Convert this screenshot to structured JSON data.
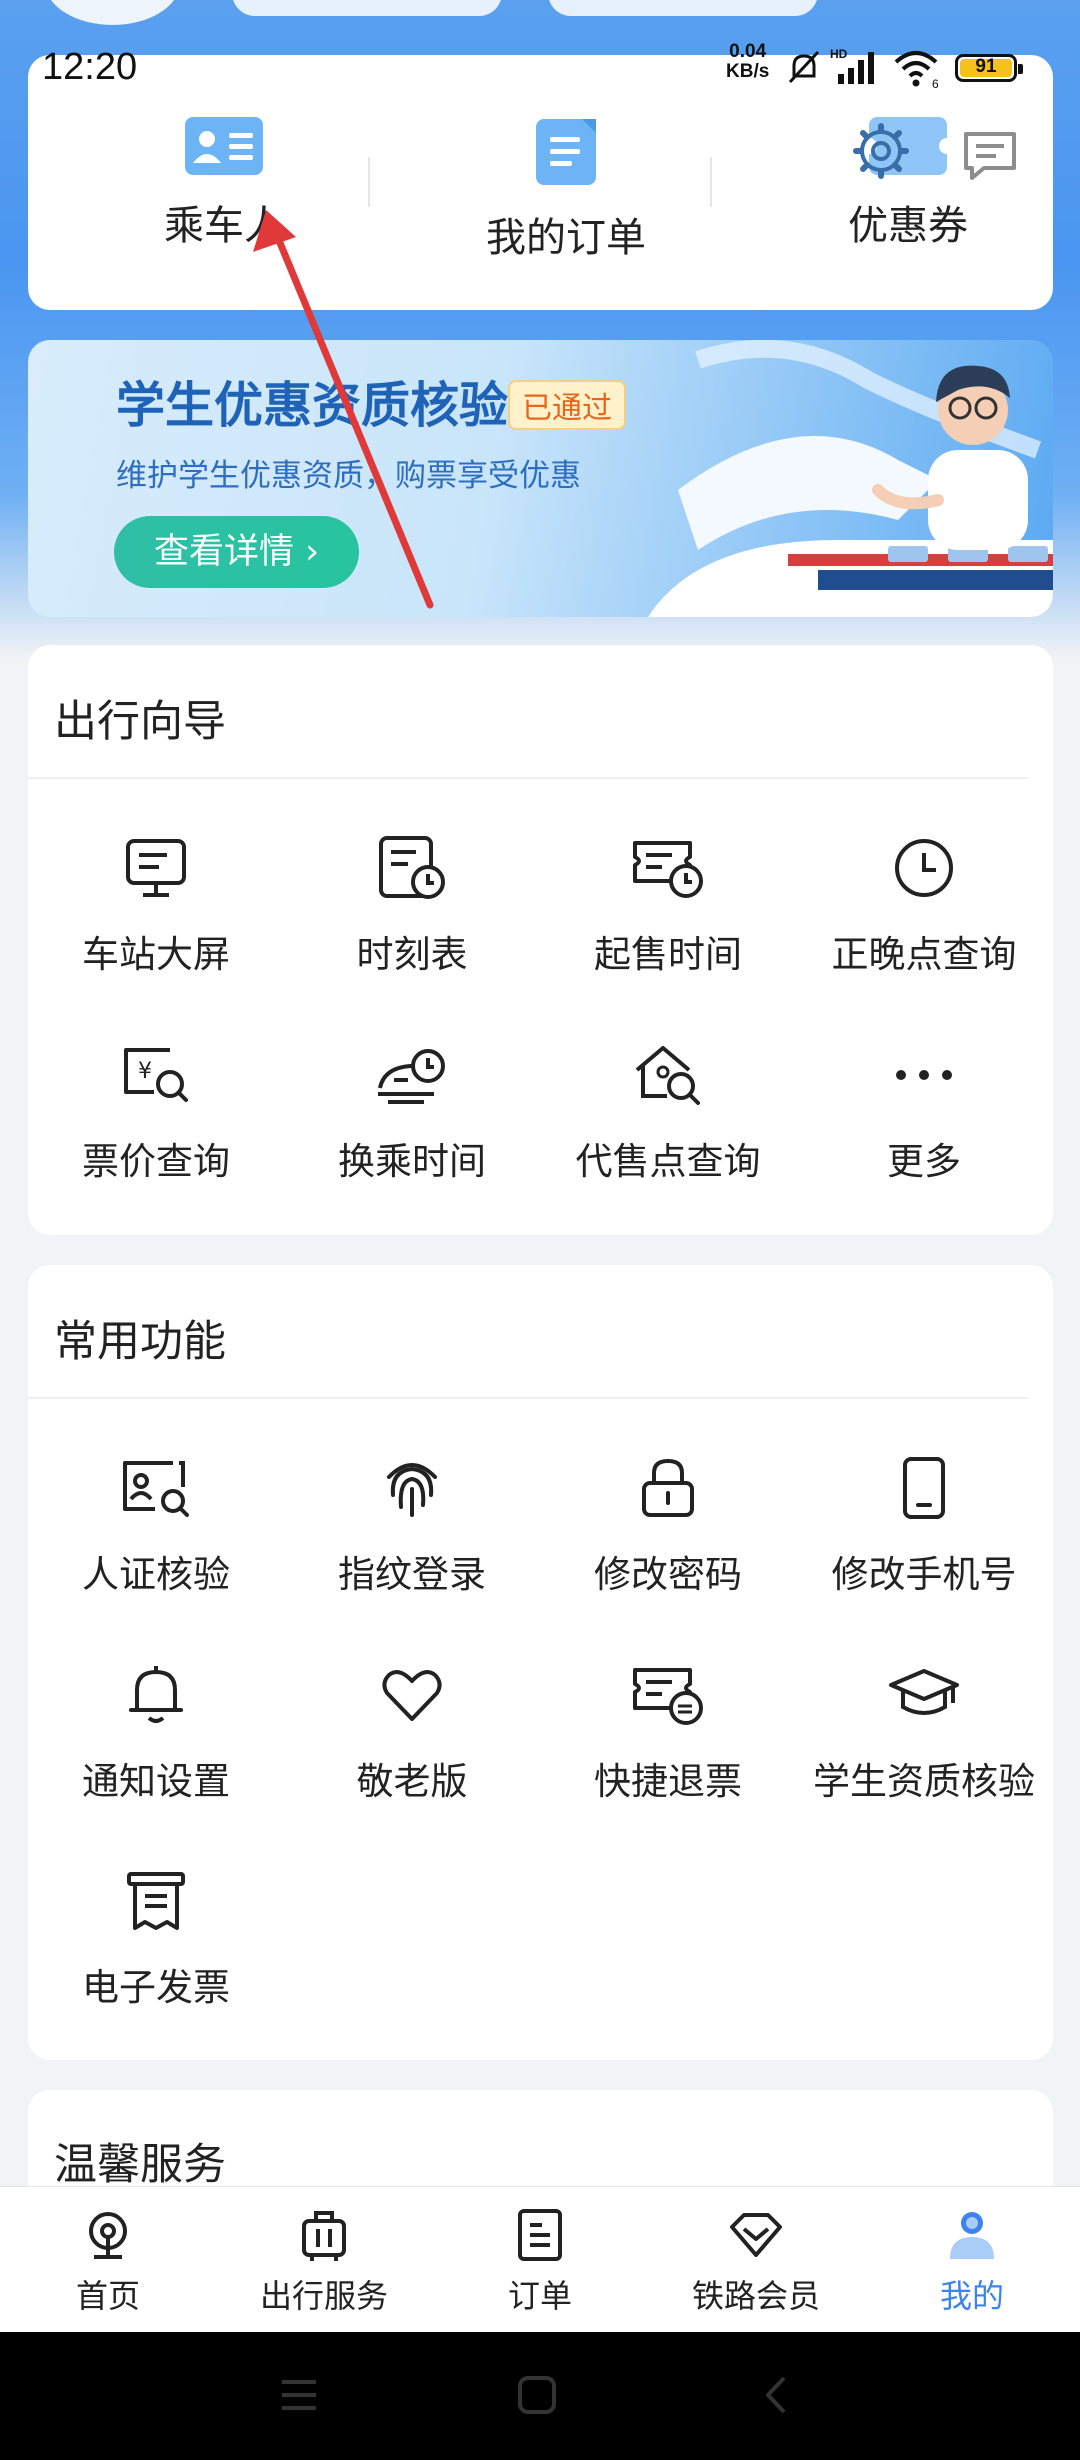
{
  "status_bar": {
    "time": "12:20",
    "net_speed": "0.04",
    "net_unit": "KB/s",
    "battery": "91"
  },
  "quick_links": [
    {
      "label": "乘车人",
      "icon": "passenger-card-icon"
    },
    {
      "label": "我的订单",
      "icon": "order-document-icon"
    },
    {
      "label": "优惠券",
      "icon": "coupon-icon"
    }
  ],
  "header_icons": [
    "settings-gear-icon",
    "message-icon"
  ],
  "banner": {
    "title": "学生优惠资质核验",
    "badge": "已通过",
    "subtitle": "维护学生优惠资质，购票享受优惠",
    "button": "查看详情 ›"
  },
  "travel_guide": {
    "title": "出行向导",
    "items": [
      {
        "label": "车站大屏",
        "icon": "station-screen-icon"
      },
      {
        "label": "时刻表",
        "icon": "timetable-icon"
      },
      {
        "label": "起售时间",
        "icon": "sale-time-icon"
      },
      {
        "label": "正晚点查询",
        "icon": "clock-icon"
      },
      {
        "label": "票价查询",
        "icon": "fare-search-icon"
      },
      {
        "label": "换乘时间",
        "icon": "transfer-time-icon"
      },
      {
        "label": "代售点查询",
        "icon": "agency-search-icon"
      },
      {
        "label": "更多",
        "icon": "more-dots-icon"
      }
    ]
  },
  "common_functions": {
    "title": "常用功能",
    "items": [
      {
        "label": "人证核验",
        "icon": "id-verify-icon"
      },
      {
        "label": "指纹登录",
        "icon": "fingerprint-icon"
      },
      {
        "label": "修改密码",
        "icon": "lock-icon"
      },
      {
        "label": "修改手机号",
        "icon": "phone-icon"
      },
      {
        "label": "通知设置",
        "icon": "bell-icon"
      },
      {
        "label": "敬老版",
        "icon": "heart-icon"
      },
      {
        "label": "快捷退票",
        "icon": "refund-ticket-icon"
      },
      {
        "label": "学生资质核验",
        "icon": "graduation-cap-icon"
      },
      {
        "label": "电子发票",
        "icon": "e-invoice-icon"
      }
    ]
  },
  "warm_service": {
    "title": "温馨服务"
  },
  "tab_bar": [
    {
      "label": "首页",
      "icon": "home-icon",
      "active": false
    },
    {
      "label": "出行服务",
      "icon": "luggage-icon",
      "active": false
    },
    {
      "label": "订单",
      "icon": "order-icon",
      "active": false
    },
    {
      "label": "铁路会员",
      "icon": "diamond-icon",
      "active": false
    },
    {
      "label": "我的",
      "icon": "profile-icon",
      "active": true
    }
  ],
  "colors": {
    "accent": "#3c83f0",
    "header_blue": "#4a96f0",
    "annotation_arrow": "#e0393a"
  }
}
